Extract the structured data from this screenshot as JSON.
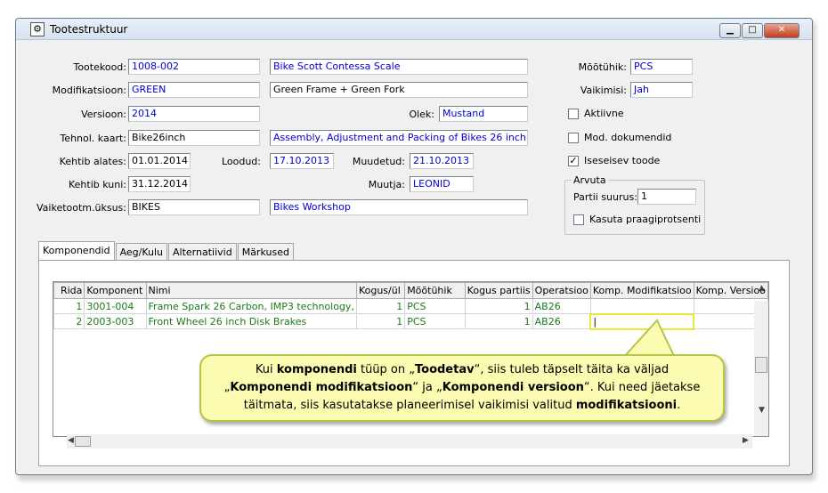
{
  "window": {
    "title": "Tootestruktuur",
    "min": "▁",
    "max": "□",
    "close": "✕"
  },
  "form": {
    "tootekood_label": "Tootekood:",
    "tootekood": "1008-002",
    "tootekood_name": "Bike Scott Contessa Scale",
    "modifikatsioon_label": "Modifikatsioon:",
    "modifikatsioon": "GREEN",
    "modifikatsioon_name": "Green Frame + Green Fork",
    "versioon_label": "Versioon:",
    "versioon": "2014",
    "olek_label": "Olek:",
    "olek": "Mustand",
    "tehnol_label": "Tehnol. kaart:",
    "tehnol": "Bike26inch",
    "tehnol_name": "Assembly, Adjustment and Packing of Bikes 26 inch",
    "kehtib_alates_label": "Kehtib alates:",
    "kehtib_alates": "01.01.2014",
    "loodud_label": "Loodud:",
    "loodud": "17.10.2013",
    "muudetud_label": "Muudetud:",
    "muudetud": "21.10.2013 1",
    "kehtib_kuni_label": "Kehtib kuni:",
    "kehtib_kuni": "31.12.2014",
    "muutja_label": "Muutja:",
    "muutja": "LEONID",
    "vaiketootm_label": "Vaiketootm.üksus:",
    "vaiketootm": "BIKES",
    "vaiketootm_name": "Bikes Workshop",
    "mootuhik_label": "Mõõtühik:",
    "mootuhik": "PCS",
    "vaikimisi_label": "Vaikimisi:",
    "vaikimisi": "Jah",
    "aktiivne_label": "Aktiivne",
    "aktiivne_checked": false,
    "mod_dok_label": "Mod. dokumendid",
    "mod_dok_checked": false,
    "iseseisev_label": "Iseseisev toode",
    "iseseisev_checked": true,
    "arvuta_label": "Arvuta",
    "partii_label": "Partii suurus:",
    "partii": "1",
    "praak_label": "Kasuta praagiprotsenti",
    "praak_checked": false
  },
  "tabs": [
    {
      "label": "Komponendid",
      "active": true
    },
    {
      "label": "Aeg/Kulu",
      "active": false
    },
    {
      "label": "Alternatiivid",
      "active": false
    },
    {
      "label": "Märkused",
      "active": false
    }
  ],
  "grid": {
    "columns": [
      "Rida",
      "Komponent",
      "Nimi",
      "Kogus/ül",
      "Mõõtühik",
      "Kogus partiis",
      "Operatsioo",
      "Komp. Modifikatsioo",
      "Komp. Versioo"
    ],
    "rows": [
      {
        "rida": "1",
        "komponent": "3001-004",
        "nimi": "Frame Spark 26 Carbon, IMP3 technology,",
        "kogus": "1",
        "mootuhik": "PCS",
        "kogus_partiis": "1",
        "operatsioon": "AB26",
        "komp_mod": "",
        "komp_ver": ""
      },
      {
        "rida": "2",
        "komponent": "2003-003",
        "nimi": "Front Wheel 26 inch Disk Brakes",
        "kogus": "1",
        "mootuhik": "PCS",
        "kogus_partiis": "1",
        "operatsioon": "AB26",
        "komp_mod": "|",
        "komp_ver": ""
      }
    ]
  },
  "callout": {
    "t1": "Kui ",
    "b1": "komponendi",
    "t2": " tüüp on „",
    "b2": "Toodetav",
    "t3": "“, siis tuleb täpselt täita ka väljad",
    "t4": "„",
    "b3": "Komponendi modifikatsioon",
    "t5": "“ ja „",
    "b4": "Komponendi versioon",
    "t6": "“.  Kui need jäetakse",
    "t7": "täitmata, siis kasutatakse planeerimisel vaikimisi valitud ",
    "b5": "modifikatsiooni",
    "t8": "."
  }
}
